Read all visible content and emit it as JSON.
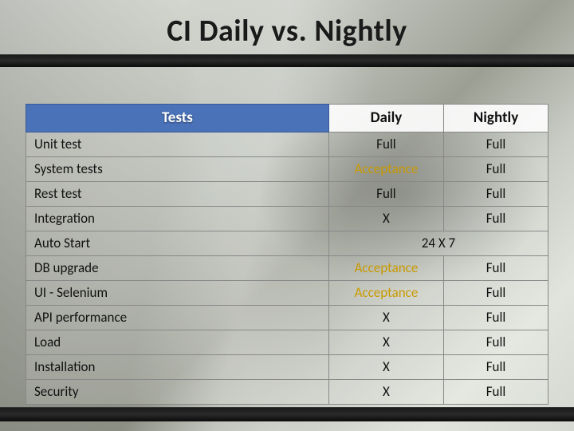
{
  "title": "CI Daily vs. Nightly",
  "headers": {
    "tests": "Tests",
    "daily": "Daily",
    "nightly": "Nightly"
  },
  "rows": [
    {
      "name": "Unit test",
      "daily": "Full",
      "nightly": "Full",
      "daily_class": "",
      "dashed": false
    },
    {
      "name": "System tests",
      "daily": "Acceptance",
      "nightly": "Full",
      "daily_class": "acc",
      "dashed": false
    },
    {
      "name": "Rest test",
      "daily": "Full",
      "nightly": "Full",
      "daily_class": "",
      "dashed": false
    },
    {
      "name": "Integration",
      "daily": "X",
      "nightly": "Full",
      "daily_class": "xmark",
      "dashed": false
    },
    {
      "name": "Auto Start",
      "span": "24 X 7",
      "dashed": false
    },
    {
      "name": "DB upgrade",
      "daily": "Acceptance",
      "nightly": "Full",
      "daily_class": "acc",
      "dashed": false
    },
    {
      "name": "UI - Selenium",
      "daily": "Acceptance",
      "nightly": "Full",
      "daily_class": "acc",
      "dashed": false
    },
    {
      "name": "API performance",
      "daily": "X",
      "nightly": "Full",
      "daily_class": "xmark",
      "dashed": false
    },
    {
      "name": "Load",
      "daily": "X",
      "nightly": "Full",
      "daily_class": "xmark",
      "dashed": false
    },
    {
      "name": "Installation",
      "daily": "X",
      "nightly": "Full",
      "daily_class": "xmark",
      "dashed": true
    },
    {
      "name": "Security",
      "daily": "X",
      "nightly": "Full",
      "daily_class": "xmark",
      "dashed": false
    }
  ],
  "chart_data": {
    "type": "table",
    "title": "CI Daily vs. Nightly",
    "columns": [
      "Tests",
      "Daily",
      "Nightly"
    ],
    "rows": [
      [
        "Unit test",
        "Full",
        "Full"
      ],
      [
        "System tests",
        "Acceptance",
        "Full"
      ],
      [
        "Rest test",
        "Full",
        "Full"
      ],
      [
        "Integration",
        "X",
        "Full"
      ],
      [
        "Auto Start",
        "24 X 7",
        "24 X 7"
      ],
      [
        "DB upgrade",
        "Acceptance",
        "Full"
      ],
      [
        "UI - Selenium",
        "Acceptance",
        "Full"
      ],
      [
        "API performance",
        "X",
        "Full"
      ],
      [
        "Load",
        "X",
        "Full"
      ],
      [
        "Installation",
        "X",
        "Full"
      ],
      [
        "Security",
        "X",
        "Full"
      ]
    ]
  }
}
